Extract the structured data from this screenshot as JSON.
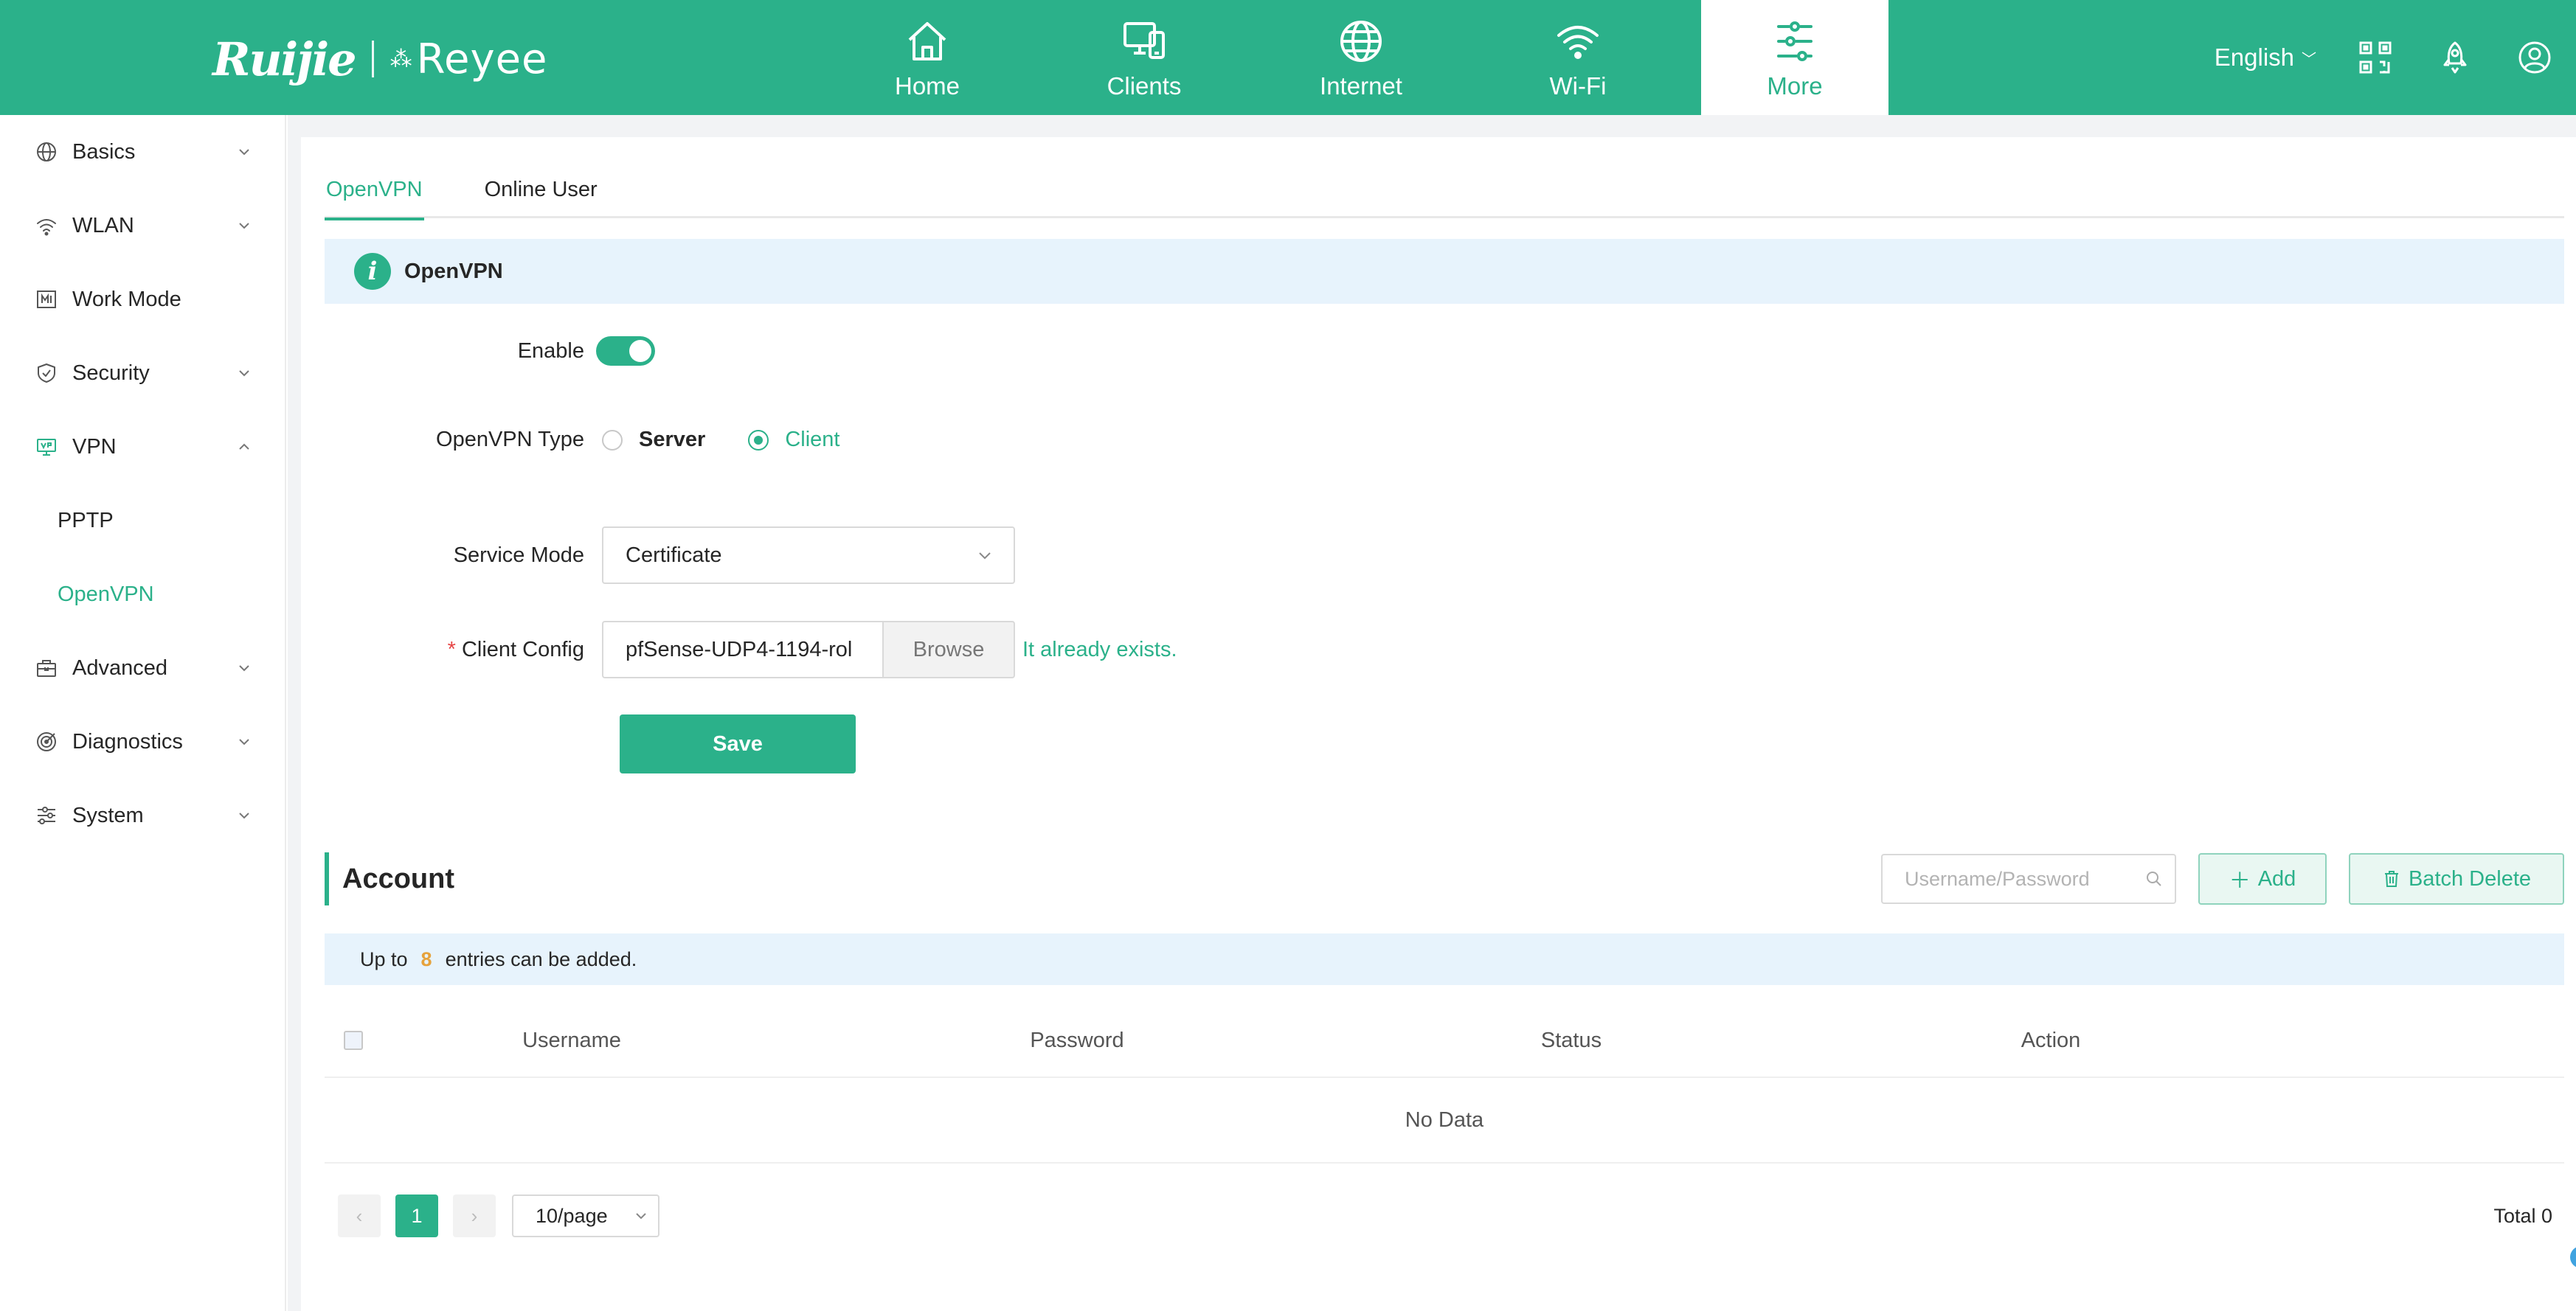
{
  "brand": {
    "logo_text": "Ruijie",
    "sub_brand": "Reyee"
  },
  "nav": {
    "items": [
      {
        "label": "Home",
        "icon": "home-icon"
      },
      {
        "label": "Clients",
        "icon": "clients-icon"
      },
      {
        "label": "Internet",
        "icon": "globe-icon"
      },
      {
        "label": "Wi-Fi",
        "icon": "wifi-icon"
      },
      {
        "label": "More",
        "icon": "more-settings-icon",
        "active": true
      }
    ],
    "language": "English"
  },
  "sidebar": {
    "items": [
      {
        "label": "Basics",
        "icon": "globe-icon"
      },
      {
        "label": "WLAN",
        "icon": "wifi-icon"
      },
      {
        "label": "Work Mode",
        "icon": "work-mode-icon"
      },
      {
        "label": "Security",
        "icon": "shield-icon"
      },
      {
        "label": "VPN",
        "icon": "vpn-icon",
        "expanded": true
      },
      {
        "label": "Advanced",
        "icon": "toolbox-icon"
      },
      {
        "label": "Diagnostics",
        "icon": "diagnostics-icon"
      },
      {
        "label": "System",
        "icon": "sliders-icon"
      }
    ],
    "vpn_sub": [
      {
        "label": "PPTP"
      },
      {
        "label": "OpenVPN",
        "active": true
      }
    ]
  },
  "tabs": [
    {
      "label": "OpenVPN",
      "active": true
    },
    {
      "label": "Online User"
    }
  ],
  "info": {
    "title": "OpenVPN"
  },
  "form": {
    "enable_label": "Enable",
    "enable_state": true,
    "type_label": "OpenVPN Type",
    "type_options": [
      "Server",
      "Client"
    ],
    "type_selected": "Client",
    "service_mode_label": "Service Mode",
    "service_mode_value": "Certificate",
    "client_config_label": "Client Config",
    "required_mark": "*",
    "client_config_value": "pfSense-UDP4-1194-rol",
    "browse_label": "Browse",
    "exists_text": "It already exists.",
    "save_label": "Save"
  },
  "account": {
    "title": "Account",
    "search_placeholder": "Username/Password",
    "add_label": "Add",
    "batch_delete_label": "Batch Delete",
    "limit_prefix": "Up to",
    "limit_count": "8",
    "limit_suffix": "entries can be added.",
    "columns": [
      "Username",
      "Password",
      "Status",
      "Action"
    ],
    "empty_text": "No Data",
    "pagination": {
      "prev": "‹",
      "current_page": "1",
      "next": "›",
      "page_size": "10/page",
      "total": "Total 0"
    }
  },
  "colors": {
    "accent": "#2bb18a",
    "info_bg": "#e7f3fc",
    "limit_num": "#e6a23c"
  }
}
